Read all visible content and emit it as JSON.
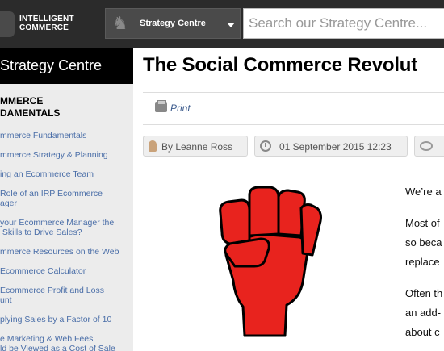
{
  "header": {
    "logo_line1": "INTELLIGENT",
    "logo_line2": "COMMERCE",
    "dropdown_label": "Strategy Centre",
    "search_placeholder": "Search our Strategy Centre..."
  },
  "sidebar": {
    "title": "Strategy Centre",
    "section_line1": "MMERCE",
    "section_line2": "DAMENTALS",
    "items": [
      "mmerce Fundamentals",
      "mmerce Strategy & Planning",
      "ing an Ecommerce Team",
      "Role of an IRP Ecommerce\nager",
      "your Ecommerce Manager the\n Skills to Drive Sales?",
      "mmerce Resources on the Web",
      "Ecommerce Calculator",
      "Ecommerce Profit and Loss\nunt",
      "plying Sales by a Factor of 10",
      "e Marketing & Web Fees\nld be Viewed as a Cost of Sale"
    ]
  },
  "article": {
    "title": "The Social Commerce Revolut",
    "print_label": "Print",
    "author": "By Leanne Ross",
    "date": "01 September 2015 12:23",
    "body_lines": [
      "We’re a",
      "Most of",
      "so beca",
      "replace",
      "Often th",
      "an add-",
      "about c"
    ]
  },
  "colors": {
    "topbar": "#2b2b2b",
    "sidebar_bg": "#ececec",
    "link": "#4a6ea8",
    "fist_red": "#e8231e"
  }
}
